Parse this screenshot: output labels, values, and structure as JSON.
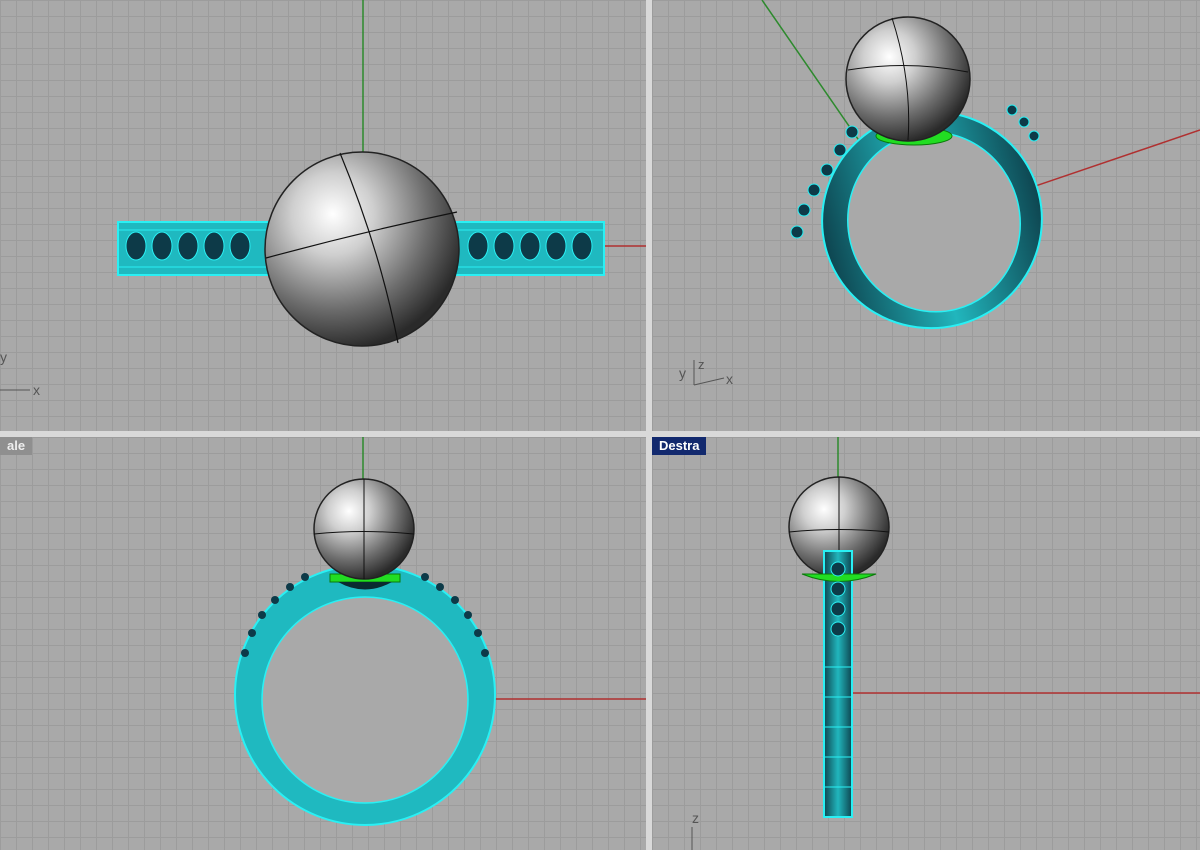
{
  "viewports": {
    "top": {
      "label": "",
      "axis_x": "x",
      "axis_y": "y"
    },
    "perspective": {
      "label": "",
      "axis_x": "x",
      "axis_y": "y",
      "axis_z": "z"
    },
    "front": {
      "label": "ale"
    },
    "right": {
      "label": "Destra",
      "axis_z": "z"
    }
  },
  "colors": {
    "viewport_bg": "#a9a9a9",
    "grid": "#9c9c9c",
    "selection_cyan": "#22e0e6",
    "setting_green": "#22dd22",
    "axis_red": "#b03030",
    "axis_green": "#2d8a2d",
    "active_label": "#12296e"
  }
}
